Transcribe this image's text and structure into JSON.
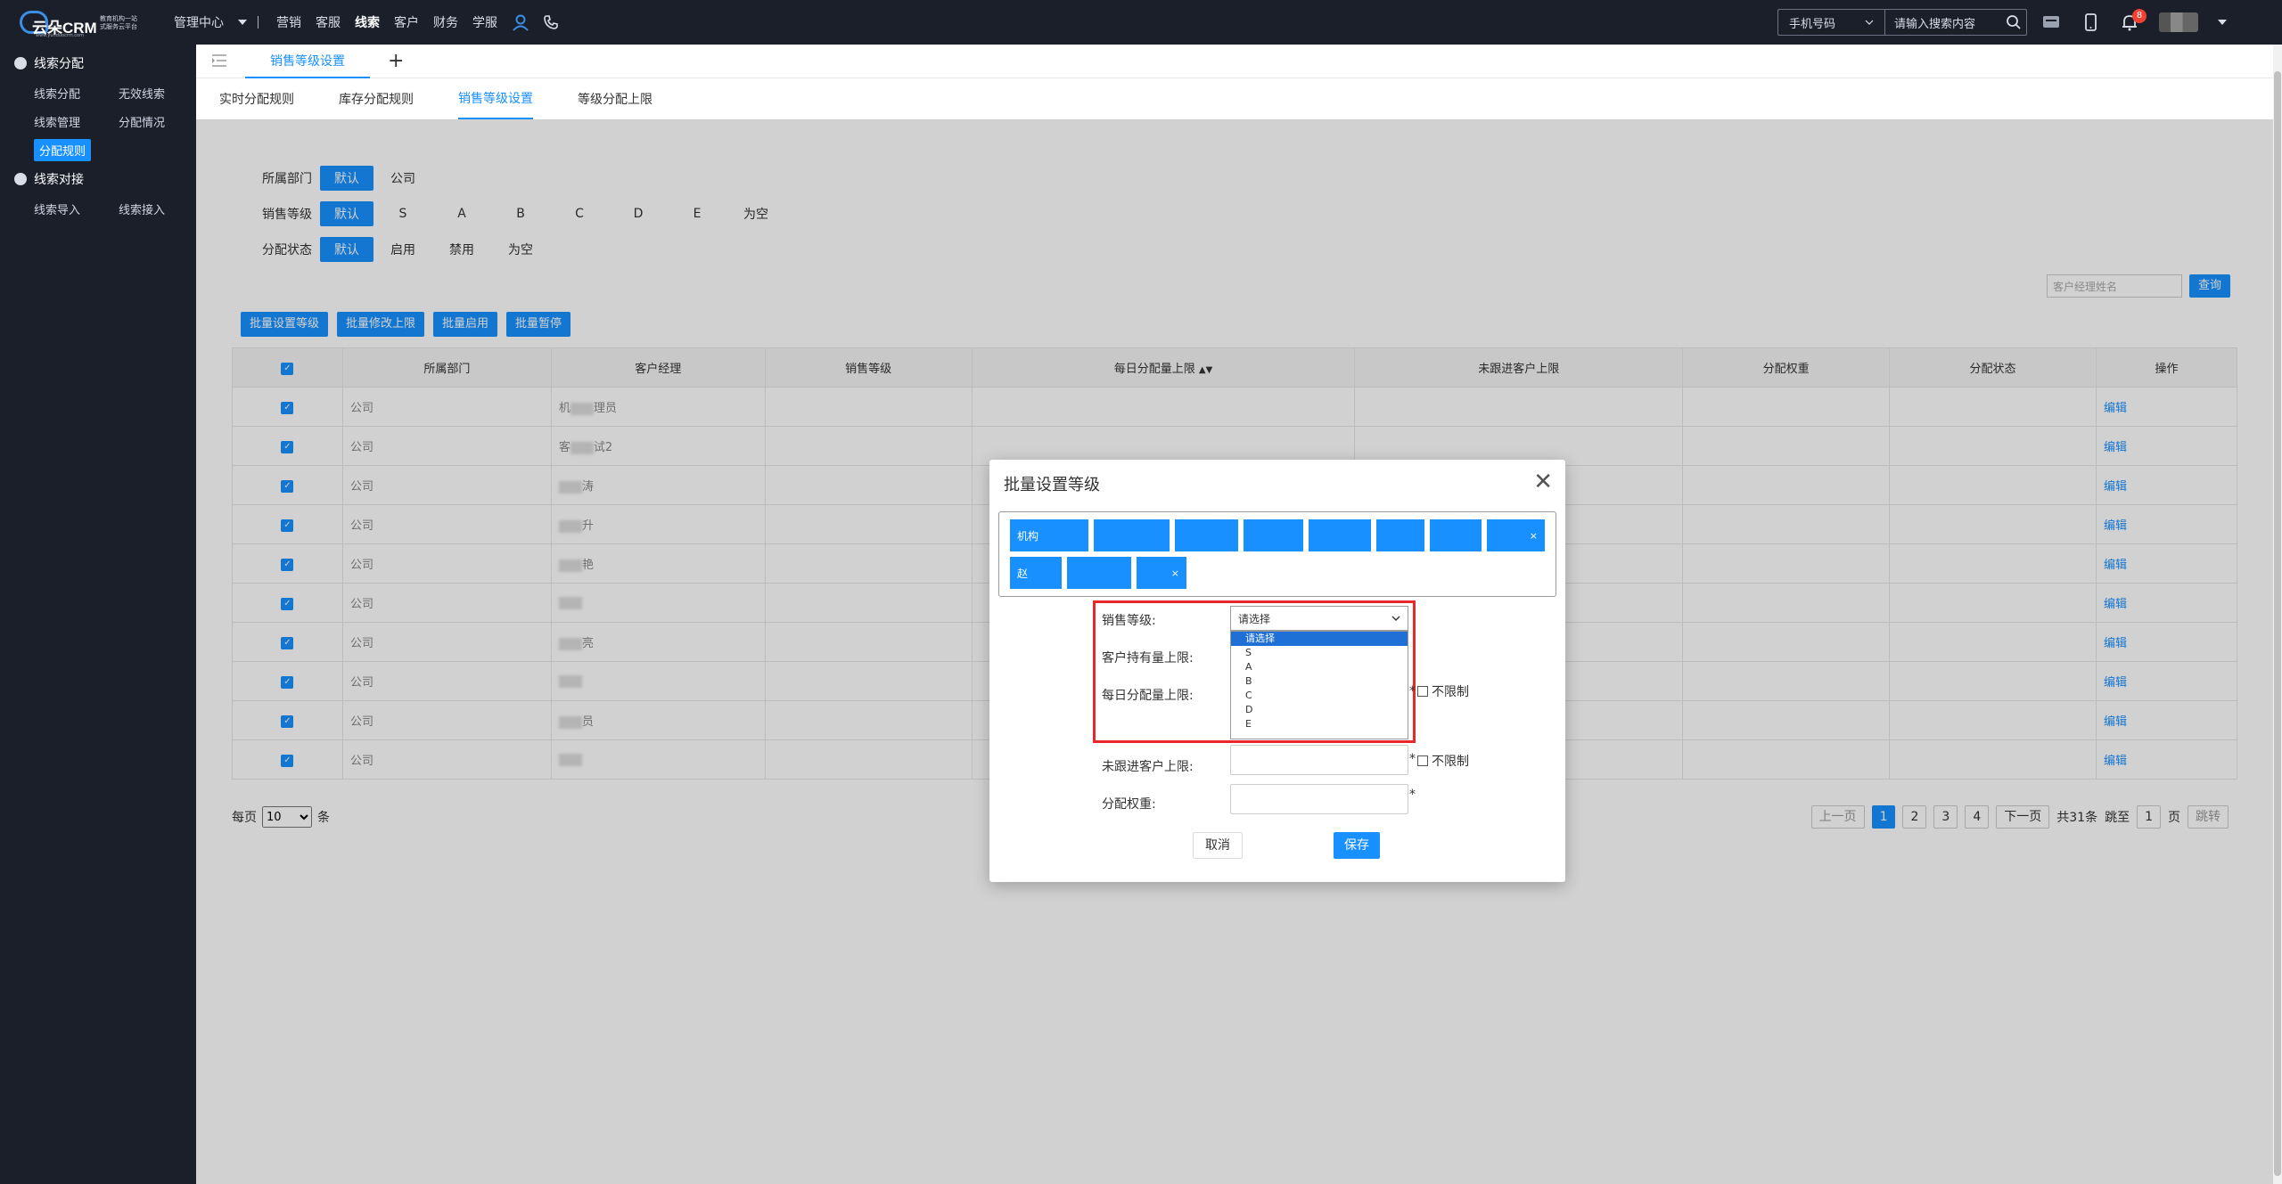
{
  "top": {
    "logo": {
      "name": "云朵CRM",
      "sub_line1": "教育机构一站",
      "sub_line2": "式服务云平台",
      "url": "www.yunduocrm.com"
    },
    "nav": [
      "管理中心",
      "营销",
      "客服",
      "线索",
      "客户",
      "财务",
      "学服"
    ],
    "nav_active": "线索",
    "search": {
      "type": "手机号码",
      "placeholder": "请输入搜索内容"
    },
    "notification_count": "8"
  },
  "sidebar": {
    "group1": "线索分配",
    "group1_items": [
      "线索分配",
      "无效线索",
      "线索管理",
      "分配情况",
      "分配规则"
    ],
    "group2": "线索对接",
    "group2_items": [
      "线索导入",
      "线索接入"
    ]
  },
  "tabbar": {
    "active_tab": "销售等级设置",
    "plus": "+"
  },
  "subtabs": [
    "实时分配规则",
    "库存分配规则",
    "销售等级设置",
    "等级分配上限"
  ],
  "filters": {
    "dept_label": "所属部门",
    "dept_opts": [
      "默认",
      "公司"
    ],
    "level_label": "销售等级",
    "level_opts": [
      "默认",
      "S",
      "A",
      "B",
      "C",
      "D",
      "E",
      "为空"
    ],
    "status_label": "分配状态",
    "status_opts": [
      "默认",
      "启用",
      "禁用",
      "为空"
    ]
  },
  "search_manager": {
    "placeholder": "客户经理姓名",
    "button": "查询"
  },
  "actions": [
    "批量设置等级",
    "批量修改上限",
    "批量启用",
    "批量暂停"
  ],
  "table": {
    "headers": [
      "所属部门",
      "客户经理",
      "销售等级",
      "每日分配量上限",
      "未跟进客户上限",
      "分配权重",
      "分配状态",
      "操作"
    ],
    "rows": [
      {
        "dept": "公司",
        "manager": "机",
        "manager_tail": "理员",
        "edit": "编辑"
      },
      {
        "dept": "公司",
        "manager": "客",
        "manager_tail": "试2",
        "edit": "编辑"
      },
      {
        "dept": "公司",
        "manager": "",
        "manager_tail": "涛",
        "edit": "编辑"
      },
      {
        "dept": "公司",
        "manager": "",
        "manager_tail": "升",
        "edit": "编辑"
      },
      {
        "dept": "公司",
        "manager": "",
        "manager_tail": "艳",
        "edit": "编辑"
      },
      {
        "dept": "公司",
        "manager": "",
        "manager_tail": "",
        "edit": "编辑"
      },
      {
        "dept": "公司",
        "manager": "",
        "manager_tail": "亮",
        "edit": "编辑"
      },
      {
        "dept": "公司",
        "manager": "",
        "manager_tail": "",
        "edit": "编辑"
      },
      {
        "dept": "公司",
        "manager": "",
        "manager_tail": "员",
        "edit": "编辑"
      },
      {
        "dept": "公司",
        "manager": "",
        "manager_tail": "",
        "edit": "编辑"
      }
    ]
  },
  "pager": {
    "per_page_label": "每页",
    "per_page_value": "10",
    "per_page_unit": "条",
    "prev": "上一页",
    "pages": [
      "1",
      "2",
      "3",
      "4"
    ],
    "current_page": "1",
    "next": "下一页",
    "total": "共31条",
    "jump_label": "跳至",
    "jump_value": "1",
    "page_unit": "页",
    "jump_button": "跳转"
  },
  "dialog": {
    "title": "批量设置等级",
    "tags_row1": [
      "机构",
      "",
      "",
      "",
      "",
      "",
      "",
      ""
    ],
    "tags_row2": [
      "赵",
      "",
      ""
    ],
    "tag_close": "×",
    "level_label": "销售等级:",
    "select_value": "请选择",
    "options": [
      "请选择",
      "S",
      "A",
      "B",
      "C",
      "D",
      "E"
    ],
    "hold_label": "客户持有量上限:",
    "daily_label": "每日分配量上限:",
    "unfollow_label": "未跟进客户上限:",
    "weight_label": "分配权重:",
    "no_limit": "不限制",
    "star": "*",
    "cancel": "取消",
    "save": "保存"
  }
}
